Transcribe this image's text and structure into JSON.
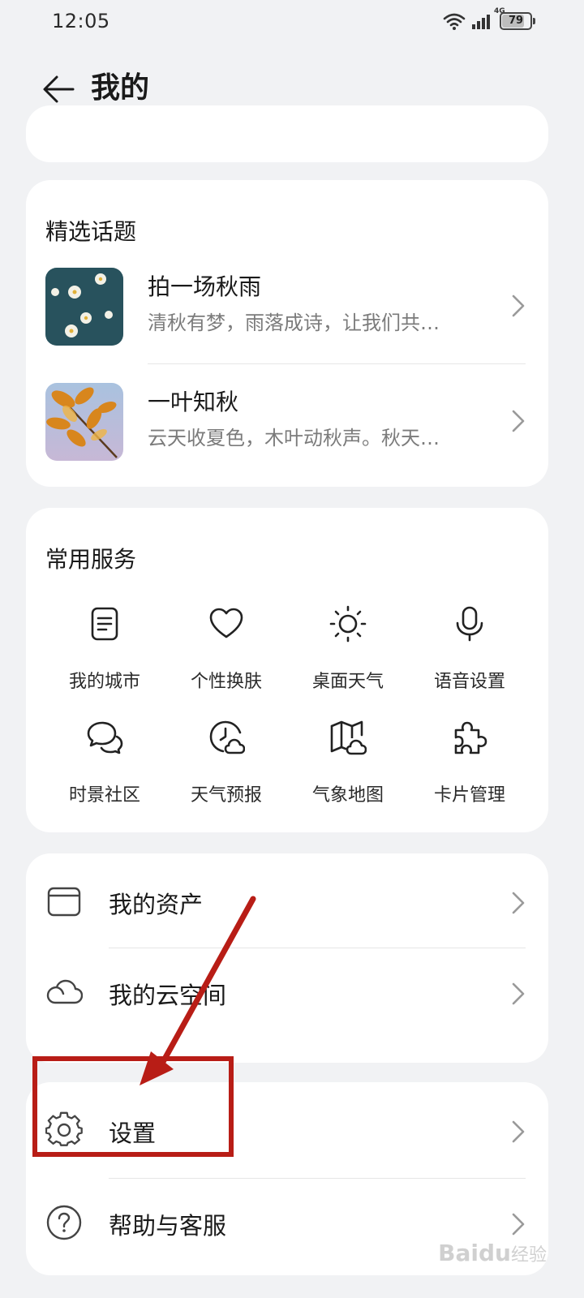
{
  "status_bar": {
    "time": "12:05",
    "network": "4G",
    "battery_level": 79,
    "battery_label": "79",
    "icons": [
      "wifi-icon",
      "signal-icon",
      "battery-icon"
    ]
  },
  "header": {
    "back_icon": "arrow-left-icon",
    "title": "我的"
  },
  "topics": {
    "title": "精选话题",
    "items": [
      {
        "title": "拍一场秋雨",
        "description": "清秋有梦，雨落成诗，让我们共…",
        "thumbnail": "white-flowers-on-teal"
      },
      {
        "title": "一叶知秋",
        "description": "云天收夏色，木叶动秋声。秋天…",
        "thumbnail": "autumn-leaves"
      }
    ]
  },
  "services": {
    "title": "常用服务",
    "items": [
      {
        "label": "我的城市",
        "icon": "document-icon"
      },
      {
        "label": "个性换肤",
        "icon": "heart-icon"
      },
      {
        "label": "桌面天气",
        "icon": "sun-icon"
      },
      {
        "label": "语音设置",
        "icon": "microphone-icon"
      },
      {
        "label": "时景社区",
        "icon": "chat-bubbles-icon"
      },
      {
        "label": "天气预报",
        "icon": "clock-cloud-icon"
      },
      {
        "label": "气象地图",
        "icon": "map-cloud-icon"
      },
      {
        "label": "卡片管理",
        "icon": "puzzle-icon"
      }
    ]
  },
  "assets": {
    "items": [
      {
        "label": "我的资产",
        "icon": "archive-box-icon"
      },
      {
        "label": "我的云空间",
        "icon": "cloud-icon"
      }
    ]
  },
  "settings": {
    "items": [
      {
        "label": "设置",
        "icon": "gear-icon"
      },
      {
        "label": "帮助与客服",
        "icon": "help-circle-icon"
      }
    ]
  },
  "annotation": {
    "color": "#b81d16",
    "target": "设置"
  },
  "watermark": {
    "brand": "Baidu",
    "sub": "经验"
  },
  "colors": {
    "background": "#f1f2f4",
    "card": "#ffffff",
    "secondary_text": "#7b7b7b",
    "annotation_red": "#b81d16"
  }
}
